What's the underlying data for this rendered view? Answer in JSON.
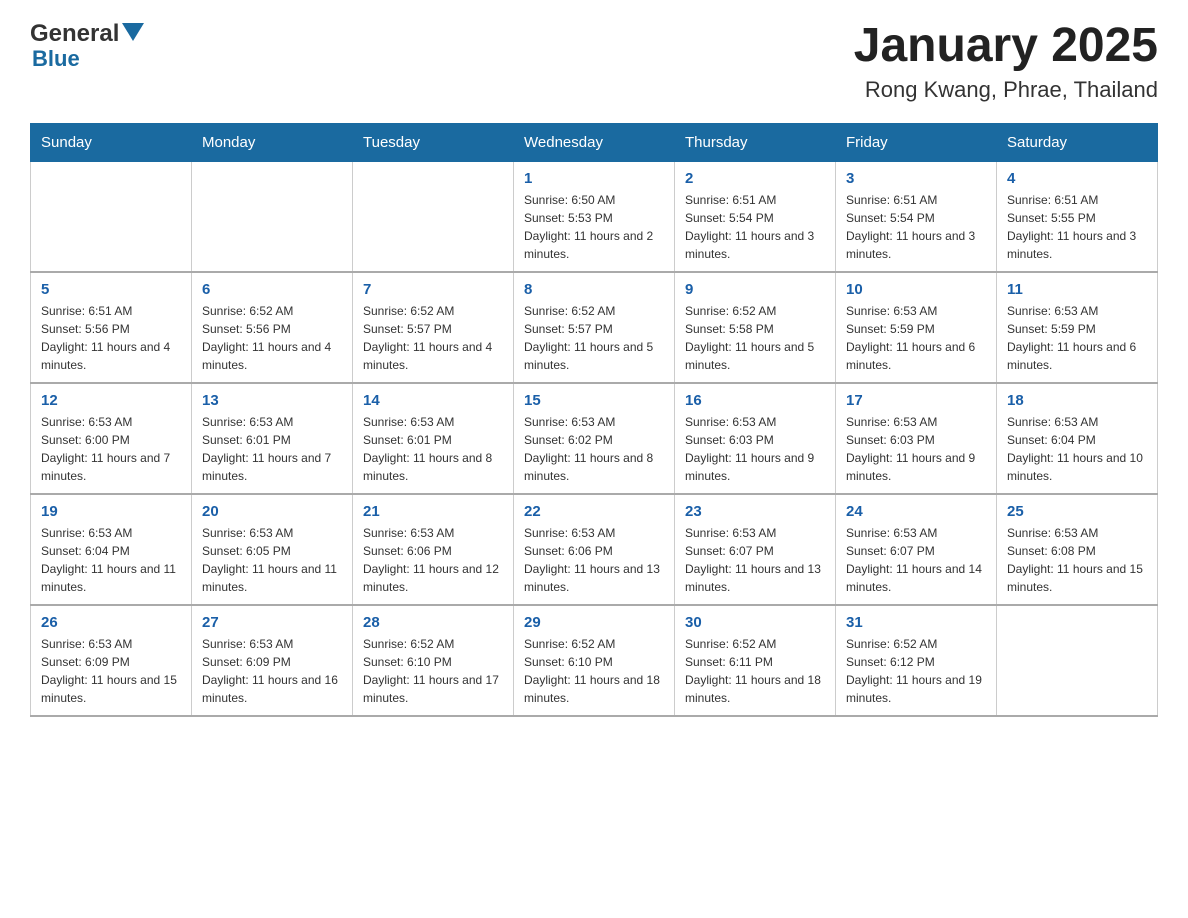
{
  "header": {
    "logo_general": "General",
    "logo_blue": "Blue",
    "month_title": "January 2025",
    "location": "Rong Kwang, Phrae, Thailand"
  },
  "days_of_week": [
    "Sunday",
    "Monday",
    "Tuesday",
    "Wednesday",
    "Thursday",
    "Friday",
    "Saturday"
  ],
  "weeks": [
    [
      {
        "day": "",
        "info": ""
      },
      {
        "day": "",
        "info": ""
      },
      {
        "day": "",
        "info": ""
      },
      {
        "day": "1",
        "info": "Sunrise: 6:50 AM\nSunset: 5:53 PM\nDaylight: 11 hours and 2 minutes."
      },
      {
        "day": "2",
        "info": "Sunrise: 6:51 AM\nSunset: 5:54 PM\nDaylight: 11 hours and 3 minutes."
      },
      {
        "day": "3",
        "info": "Sunrise: 6:51 AM\nSunset: 5:54 PM\nDaylight: 11 hours and 3 minutes."
      },
      {
        "day": "4",
        "info": "Sunrise: 6:51 AM\nSunset: 5:55 PM\nDaylight: 11 hours and 3 minutes."
      }
    ],
    [
      {
        "day": "5",
        "info": "Sunrise: 6:51 AM\nSunset: 5:56 PM\nDaylight: 11 hours and 4 minutes."
      },
      {
        "day": "6",
        "info": "Sunrise: 6:52 AM\nSunset: 5:56 PM\nDaylight: 11 hours and 4 minutes."
      },
      {
        "day": "7",
        "info": "Sunrise: 6:52 AM\nSunset: 5:57 PM\nDaylight: 11 hours and 4 minutes."
      },
      {
        "day": "8",
        "info": "Sunrise: 6:52 AM\nSunset: 5:57 PM\nDaylight: 11 hours and 5 minutes."
      },
      {
        "day": "9",
        "info": "Sunrise: 6:52 AM\nSunset: 5:58 PM\nDaylight: 11 hours and 5 minutes."
      },
      {
        "day": "10",
        "info": "Sunrise: 6:53 AM\nSunset: 5:59 PM\nDaylight: 11 hours and 6 minutes."
      },
      {
        "day": "11",
        "info": "Sunrise: 6:53 AM\nSunset: 5:59 PM\nDaylight: 11 hours and 6 minutes."
      }
    ],
    [
      {
        "day": "12",
        "info": "Sunrise: 6:53 AM\nSunset: 6:00 PM\nDaylight: 11 hours and 7 minutes."
      },
      {
        "day": "13",
        "info": "Sunrise: 6:53 AM\nSunset: 6:01 PM\nDaylight: 11 hours and 7 minutes."
      },
      {
        "day": "14",
        "info": "Sunrise: 6:53 AM\nSunset: 6:01 PM\nDaylight: 11 hours and 8 minutes."
      },
      {
        "day": "15",
        "info": "Sunrise: 6:53 AM\nSunset: 6:02 PM\nDaylight: 11 hours and 8 minutes."
      },
      {
        "day": "16",
        "info": "Sunrise: 6:53 AM\nSunset: 6:03 PM\nDaylight: 11 hours and 9 minutes."
      },
      {
        "day": "17",
        "info": "Sunrise: 6:53 AM\nSunset: 6:03 PM\nDaylight: 11 hours and 9 minutes."
      },
      {
        "day": "18",
        "info": "Sunrise: 6:53 AM\nSunset: 6:04 PM\nDaylight: 11 hours and 10 minutes."
      }
    ],
    [
      {
        "day": "19",
        "info": "Sunrise: 6:53 AM\nSunset: 6:04 PM\nDaylight: 11 hours and 11 minutes."
      },
      {
        "day": "20",
        "info": "Sunrise: 6:53 AM\nSunset: 6:05 PM\nDaylight: 11 hours and 11 minutes."
      },
      {
        "day": "21",
        "info": "Sunrise: 6:53 AM\nSunset: 6:06 PM\nDaylight: 11 hours and 12 minutes."
      },
      {
        "day": "22",
        "info": "Sunrise: 6:53 AM\nSunset: 6:06 PM\nDaylight: 11 hours and 13 minutes."
      },
      {
        "day": "23",
        "info": "Sunrise: 6:53 AM\nSunset: 6:07 PM\nDaylight: 11 hours and 13 minutes."
      },
      {
        "day": "24",
        "info": "Sunrise: 6:53 AM\nSunset: 6:07 PM\nDaylight: 11 hours and 14 minutes."
      },
      {
        "day": "25",
        "info": "Sunrise: 6:53 AM\nSunset: 6:08 PM\nDaylight: 11 hours and 15 minutes."
      }
    ],
    [
      {
        "day": "26",
        "info": "Sunrise: 6:53 AM\nSunset: 6:09 PM\nDaylight: 11 hours and 15 minutes."
      },
      {
        "day": "27",
        "info": "Sunrise: 6:53 AM\nSunset: 6:09 PM\nDaylight: 11 hours and 16 minutes."
      },
      {
        "day": "28",
        "info": "Sunrise: 6:52 AM\nSunset: 6:10 PM\nDaylight: 11 hours and 17 minutes."
      },
      {
        "day": "29",
        "info": "Sunrise: 6:52 AM\nSunset: 6:10 PM\nDaylight: 11 hours and 18 minutes."
      },
      {
        "day": "30",
        "info": "Sunrise: 6:52 AM\nSunset: 6:11 PM\nDaylight: 11 hours and 18 minutes."
      },
      {
        "day": "31",
        "info": "Sunrise: 6:52 AM\nSunset: 6:12 PM\nDaylight: 11 hours and 19 minutes."
      },
      {
        "day": "",
        "info": ""
      }
    ]
  ]
}
